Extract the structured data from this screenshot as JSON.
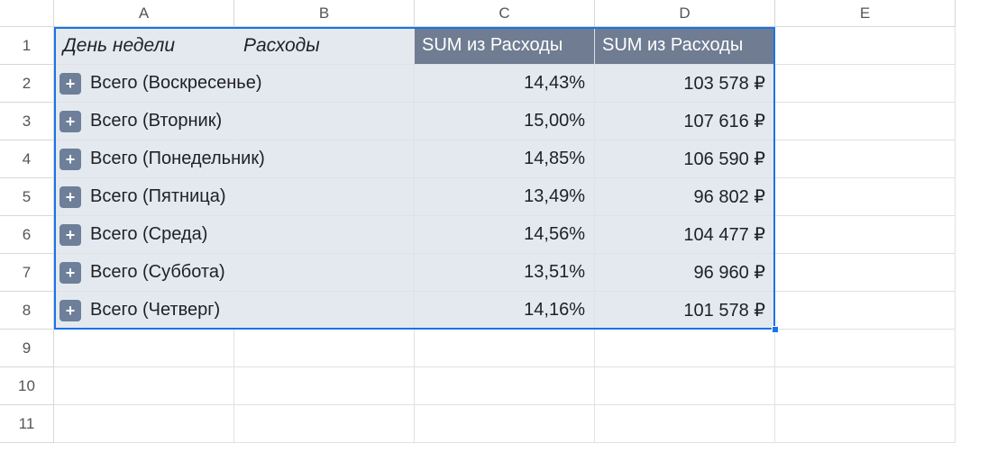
{
  "columns": [
    "A",
    "B",
    "C",
    "D",
    "E"
  ],
  "row_numbers": [
    1,
    2,
    3,
    4,
    5,
    6,
    7,
    8,
    9,
    10,
    11
  ],
  "pivot": {
    "header_a": "День недели",
    "header_b": "Расходы",
    "header_c": "SUM из Расходы",
    "header_d": "SUM из Расходы",
    "expand_glyph": "+",
    "rows": [
      {
        "label": "Всего (Воскресенье)",
        "pct": "14,43%",
        "sum": "103 578 ₽"
      },
      {
        "label": "Всего (Вторник)",
        "pct": "15,00%",
        "sum": "107 616 ₽"
      },
      {
        "label": "Всего (Понедельник)",
        "pct": "14,85%",
        "sum": "106 590 ₽"
      },
      {
        "label": "Всего (Пятница)",
        "pct": "13,49%",
        "sum": "96 802 ₽"
      },
      {
        "label": "Всего (Среда)",
        "pct": "14,56%",
        "sum": "104 477 ₽"
      },
      {
        "label": "Всего (Суббота)",
        "pct": "13,51%",
        "sum": "96 960 ₽"
      },
      {
        "label": "Всего (Четверг)",
        "pct": "14,16%",
        "sum": "101 578 ₽"
      }
    ]
  }
}
